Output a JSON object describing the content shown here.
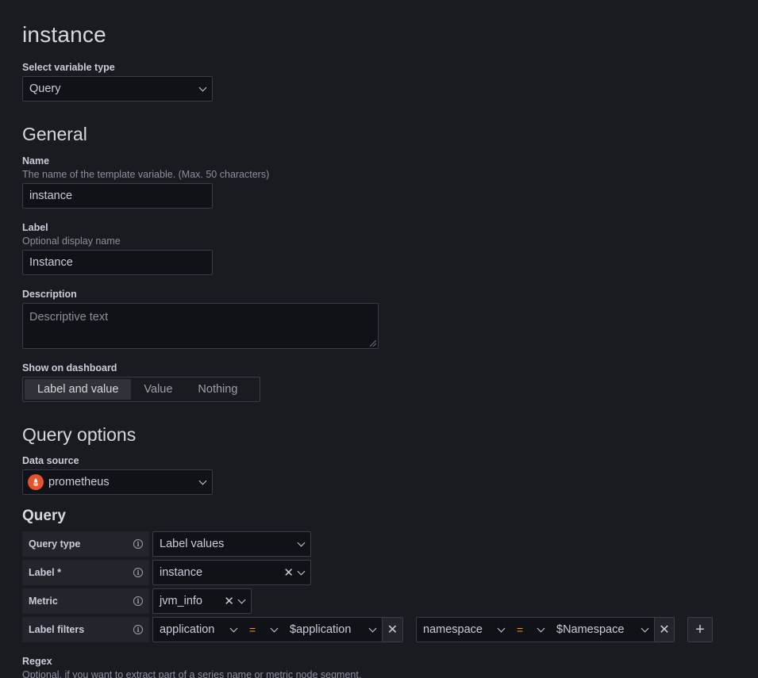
{
  "page_title": "instance",
  "variable_type": {
    "label": "Select variable type",
    "value": "Query"
  },
  "general": {
    "title": "General",
    "name": {
      "label": "Name",
      "description": "The name of the template variable. (Max. 50 characters)",
      "value": "instance"
    },
    "label": {
      "label": "Label",
      "description": "Optional display name",
      "value": "Instance"
    },
    "description": {
      "label": "Description",
      "placeholder": "Descriptive text"
    },
    "show_on_dashboard": {
      "label": "Show on dashboard",
      "options": [
        "Label and value",
        "Value",
        "Nothing"
      ],
      "selected": "Label and value"
    }
  },
  "query_options": {
    "title": "Query options",
    "data_source": {
      "label": "Data source",
      "value": "prometheus",
      "icon": "prometheus-icon",
      "icon_color": "#e6522c"
    },
    "query": {
      "title": "Query",
      "query_type": {
        "label": "Query type",
        "value": "Label values"
      },
      "label_row": {
        "label": "Label *",
        "value": "instance"
      },
      "metric": {
        "label": "Metric",
        "value": "jvm_info"
      },
      "label_filters": {
        "label": "Label filters",
        "filters": [
          {
            "key": "application",
            "op": "=",
            "value": "$application"
          },
          {
            "key": "namespace",
            "op": "=",
            "value": "$Namespace"
          }
        ],
        "add_icon": "plus-icon"
      }
    },
    "regex": {
      "label": "Regex",
      "description": "Optional, if you want to extract part of a series name or metric node segment."
    }
  },
  "colors": {
    "background": "#181b1f",
    "input_bg": "#111217",
    "border": "#3a3d45",
    "operator": "#f8961e"
  }
}
